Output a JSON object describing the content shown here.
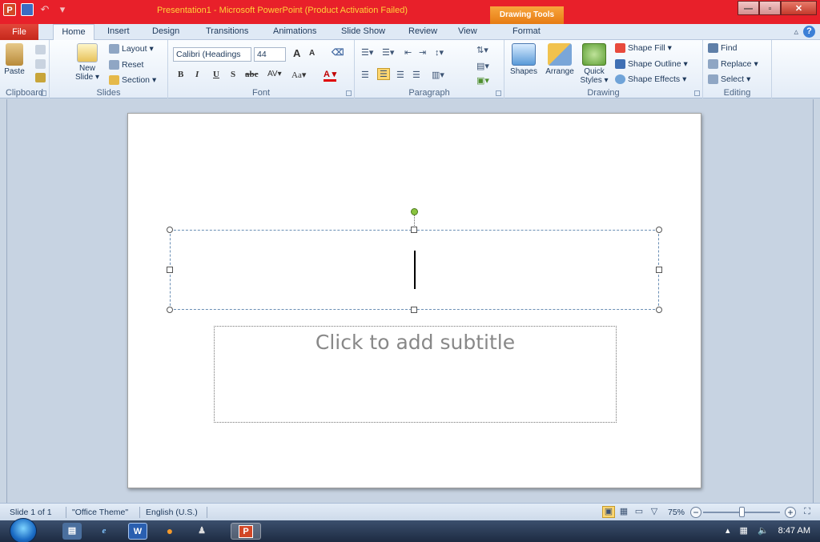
{
  "window": {
    "title": "Presentation1  -  Microsoft PowerPoint (Product Activation Failed)",
    "context_tab": "Drawing Tools",
    "min_glyph": "—",
    "max_glyph": "▫",
    "close_glyph": "✕"
  },
  "qat": {
    "app_icon": "P",
    "undo_glyph": "↶",
    "redo_glyph": "▾"
  },
  "tabs": {
    "file": "File",
    "home": "Home",
    "insert": "Insert",
    "design": "Design",
    "transitions": "Transitions",
    "animations": "Animations",
    "slideshow": "Slide Show",
    "review": "Review",
    "view": "View",
    "format": "Format"
  },
  "help": {
    "minimize_glyph": "▵",
    "help_glyph": "?"
  },
  "ribbon": {
    "clipboard": {
      "label": "Clipboard",
      "paste": "Paste"
    },
    "slides": {
      "label": "Slides",
      "new_slide_line1": "New",
      "new_slide_line2": "Slide ▾",
      "layout": "Layout ▾",
      "reset": "Reset",
      "section": "Section ▾"
    },
    "font": {
      "label": "Font",
      "font_name": "Calibri (Headings",
      "font_size": "44",
      "grow": "A",
      "shrink": "A",
      "bold": "B",
      "italic": "I",
      "underline": "U",
      "shadow": "S",
      "strike": "abc",
      "spacing": "AV▾",
      "case": "Aa▾",
      "color": "A ▾"
    },
    "paragraph": {
      "label": "Paragraph"
    },
    "drawing": {
      "label": "Drawing",
      "shapes": "Shapes",
      "arrange": "Arrange",
      "quick_styles_line1": "Quick",
      "quick_styles_line2": "Styles ▾",
      "shape_fill": "Shape Fill ▾",
      "shape_outline": "Shape Outline ▾",
      "shape_effects": "Shape Effects ▾"
    },
    "editing": {
      "label": "Editing",
      "find": "Find",
      "replace": "Replace ▾",
      "select": "Select ▾"
    }
  },
  "slide": {
    "subtitle_placeholder": "Click to add subtitle"
  },
  "statusbar": {
    "slide_info": "Slide 1 of 1",
    "theme": "\"Office Theme\"",
    "language": "English (U.S.)",
    "zoom": "75%",
    "zoom_out": "−",
    "zoom_in": "+",
    "zoom_level": 0.5
  },
  "taskbar": {
    "word_label": "W",
    "ppt_label": "P",
    "time": "8:47 AM"
  },
  "colors": {
    "title_bar": "#e8202a",
    "accent_orange": "#f29b38",
    "rotation_handle": "#8ac43f"
  }
}
